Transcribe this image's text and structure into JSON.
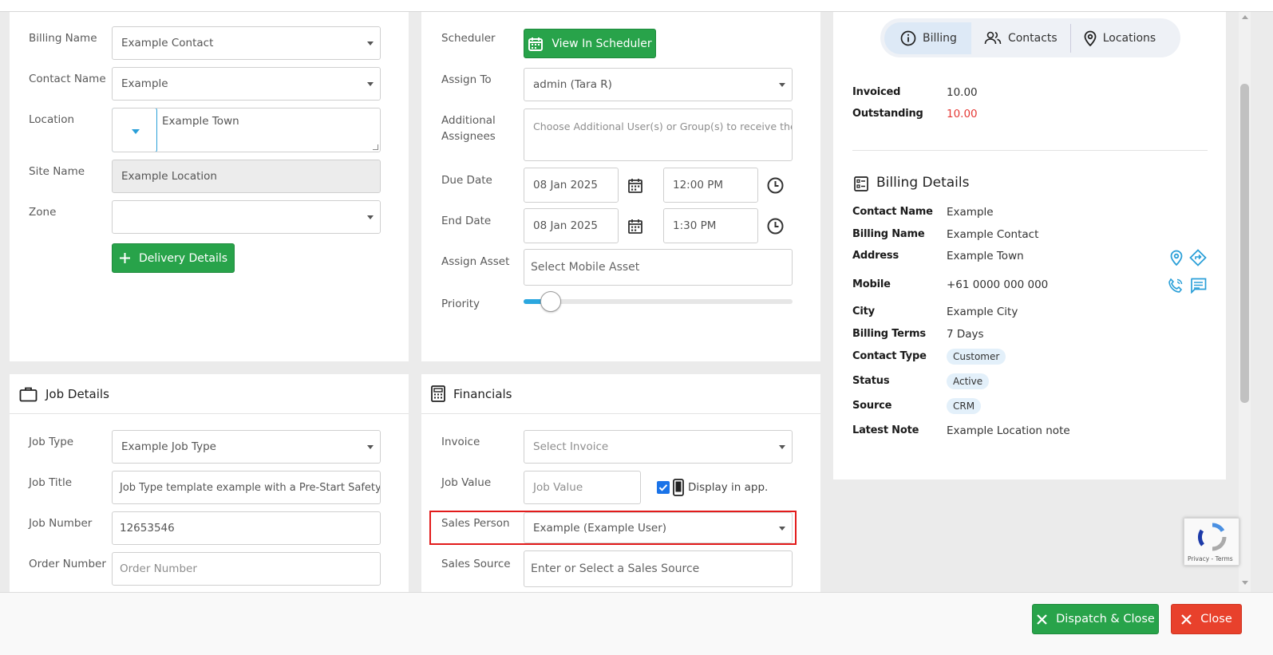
{
  "customer": {
    "billing_name_label": "Billing Name",
    "billing_name_value": "Example Contact",
    "contact_name_label": "Contact Name",
    "contact_name_value": "Example",
    "location_label": "Location",
    "location_value": "Example Town",
    "site_name_label": "Site Name",
    "site_name_value": "Example Location",
    "zone_label": "Zone",
    "zone_value": "",
    "delivery_button": "Delivery Details"
  },
  "schedule": {
    "scheduler_label": "Scheduler",
    "view_scheduler_button": "View In Scheduler",
    "assign_to_label": "Assign To",
    "assign_to_value": "admin (Tara R)",
    "additional_label_line1": "Additional",
    "additional_label_line2": "Assignees",
    "additional_placeholder": "Choose Additional User(s) or Group(s) to receive the job.",
    "due_date_label": "Due Date",
    "due_date": "08 Jan 2025",
    "due_time": "12:00 PM",
    "end_date_label": "End Date",
    "end_date": "08 Jan 2025",
    "end_time": "1:30 PM",
    "assign_asset_label": "Assign Asset",
    "assign_asset_placeholder": "Select Mobile Asset",
    "priority_label": "Priority",
    "priority_level": 0.1
  },
  "job_details": {
    "title": "Job Details",
    "job_type_label": "Job Type",
    "job_type_value": "Example Job Type",
    "job_title_label": "Job Title",
    "job_title_value": "Job Type template example with a Pre-Start Safety Q",
    "job_number_label": "Job Number",
    "job_number_value": "12653546",
    "order_number_label": "Order Number",
    "order_number_placeholder": "Order Number"
  },
  "financials": {
    "title": "Financials",
    "invoice_label": "Invoice",
    "invoice_placeholder": "Select Invoice",
    "job_value_label": "Job Value",
    "job_value_placeholder": "Job Value",
    "display_in_app": "Display in app.",
    "display_in_app_checked": true,
    "sales_person_label": "Sales Person",
    "sales_person_value": "Example (Example User)",
    "sales_source_label": "Sales Source",
    "sales_source_placeholder": "Enter or Select a Sales Source",
    "highlight_color": "#e21b1b"
  },
  "right_panel": {
    "tabs": [
      "Billing",
      "Contacts",
      "Locations"
    ],
    "invoiced_label": "Invoiced",
    "invoiced_value": "10.00",
    "outstanding_label": "Outstanding",
    "outstanding_value": "10.00",
    "outstanding_color": "#e53935",
    "billing_details_title": "Billing Details",
    "contact_name_label": "Contact Name",
    "contact_name_value": "Example",
    "billing_name_label": "Billing Name",
    "billing_name_value": "Example Contact",
    "address_label": "Address",
    "address_value": "Example Town",
    "mobile_label": "Mobile",
    "mobile_value": "+61 0000 000 000",
    "city_label": "City",
    "city_value": "Example City",
    "billing_terms_label": "Billing Terms",
    "billing_terms_value": "7 Days",
    "contact_type_label": "Contact Type",
    "contact_type_value": "Customer",
    "status_label": "Status",
    "status_value": "Active",
    "source_label": "Source",
    "source_value": "CRM",
    "latest_note_label": "Latest Note",
    "latest_note_value": "Example Location note"
  },
  "recaptcha": {
    "text": "Privacy - Terms"
  },
  "footer": {
    "dispatch_button": "Dispatch & Close",
    "close_button": "Close"
  },
  "colors": {
    "green": "#28a34a",
    "red": "#e8412c",
    "accent": "#2a9fd8"
  }
}
